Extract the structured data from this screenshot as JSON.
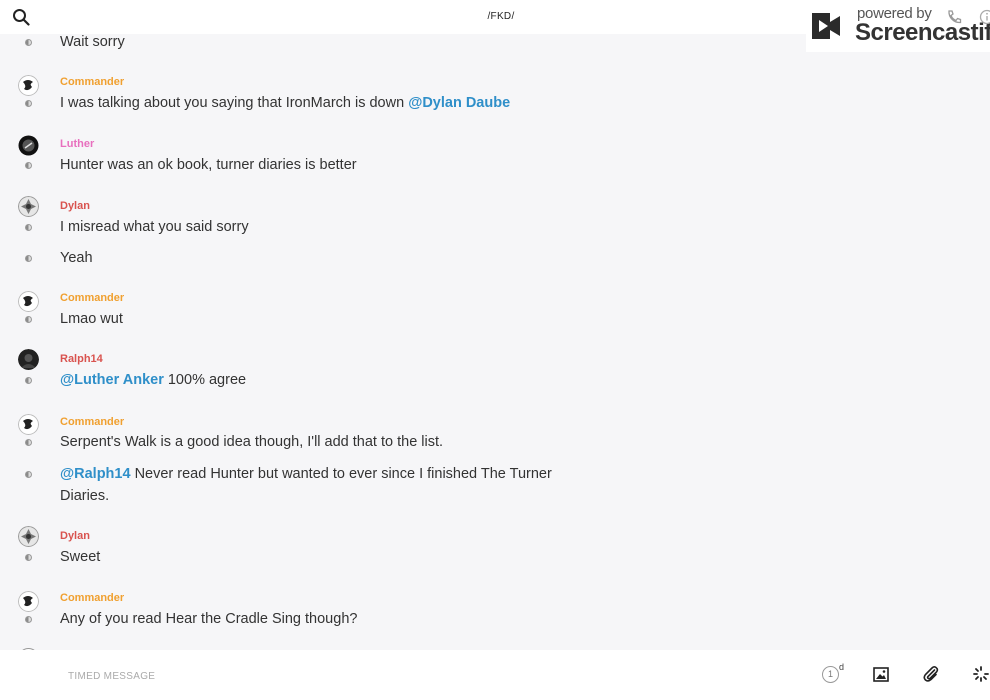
{
  "header": {
    "channel": "/FKD/"
  },
  "watermark": {
    "powered": "powered by",
    "brand": "Screencastify"
  },
  "colors": {
    "commander": "#f0a030",
    "luther": "#e86fbe",
    "dylan": "#d9534f",
    "ralph": "#d9534f",
    "mention": "#2f8fc9"
  },
  "messages": [
    {
      "text": "Wait sorry"
    },
    {
      "author": "Commander",
      "text": "I was talking about you saying that IronMarch is down ",
      "mention": "@Dylan Daube"
    },
    {
      "author": "Luther",
      "text": "Hunter was an ok book, turner diaries is better"
    },
    {
      "author": "Dylan",
      "text": "I misread what you said sorry"
    },
    {
      "text": "Yeah"
    },
    {
      "author": "Commander",
      "text": "Lmao wut"
    },
    {
      "author": "Ralph14",
      "mention": "@Luther Anker",
      "text": " 100% agree"
    },
    {
      "author": "Commander",
      "text": "Serpent's Walk is a good idea though, I'll add that to the list."
    },
    {
      "mention": "@Ralph14",
      "text": " Never read Hunter but wanted to ever since I finished The Turner Diaries."
    },
    {
      "author": "Dylan",
      "text": "Sweet"
    },
    {
      "author": "Commander",
      "text": "Any of you read Hear the Cradle Sing though?"
    }
  ],
  "composer": {
    "placeholder": "TIMED MESSAGE",
    "timer_value": "1",
    "timer_unit": "d"
  }
}
